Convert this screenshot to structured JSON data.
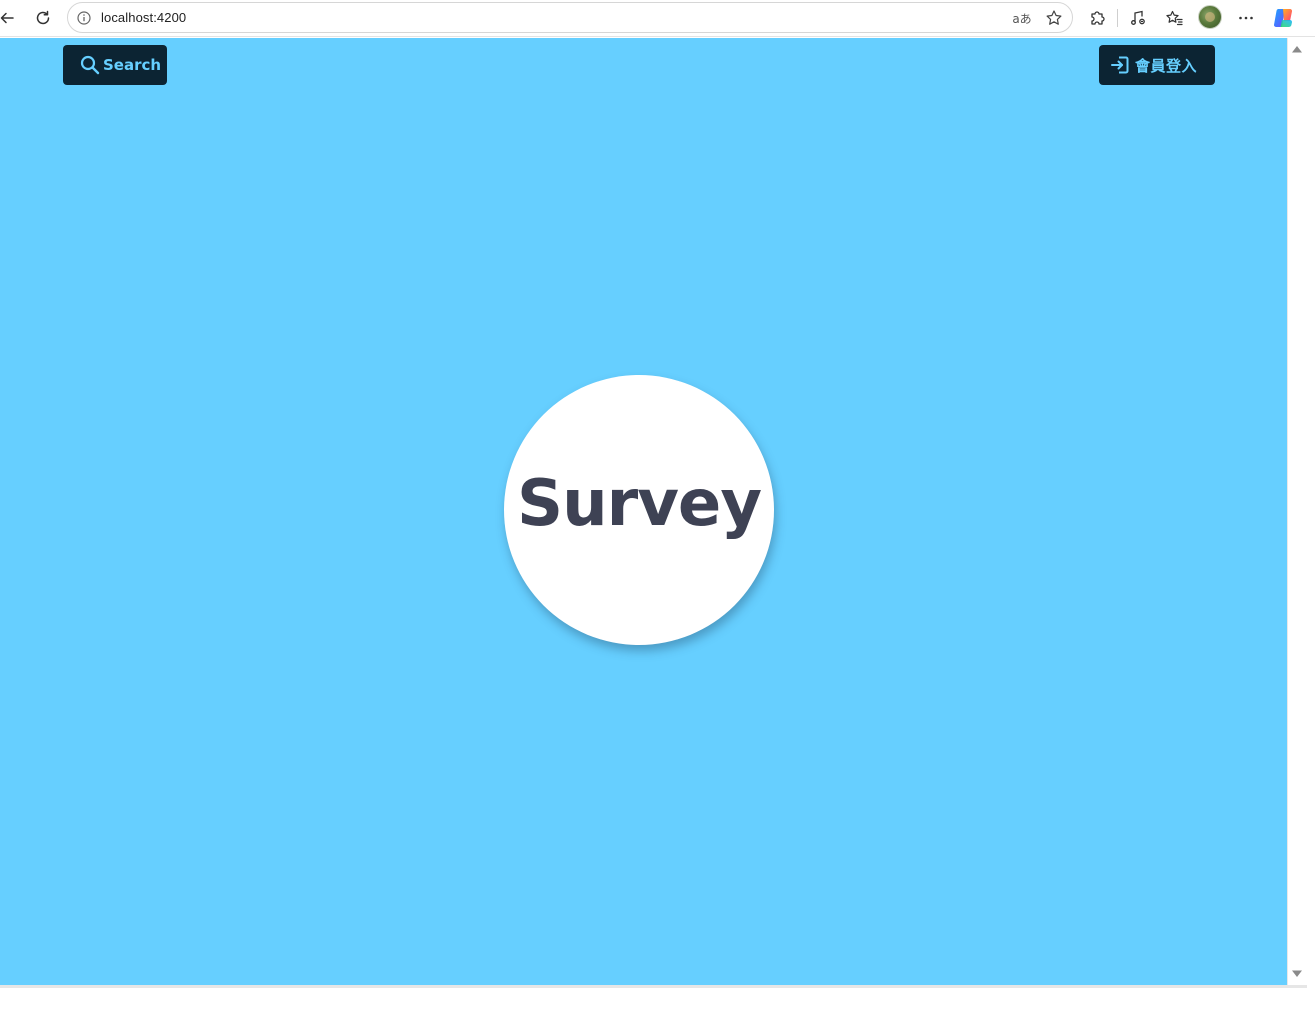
{
  "browser": {
    "url": "localhost:4200",
    "icons": {
      "back": "arrow-left-icon",
      "reload": "reload-icon",
      "site_info": "info-icon",
      "translate": "translate-icon",
      "favorite": "star-icon",
      "extensions": "puzzle-icon",
      "media": "music-note-icon",
      "favorites_list": "favorites-icon",
      "profile": "avatar",
      "menu": "more-icon",
      "copilot": "copilot-icon"
    }
  },
  "header": {
    "search_label": "Search",
    "login_label": "會員登入"
  },
  "hero": {
    "logo_text": "Survey"
  },
  "colors": {
    "page_background": "#66cfff",
    "button_background": "#0c2433",
    "button_text": "#66cfff",
    "logo_text": "#3e4254",
    "logo_circle": "#ffffff"
  }
}
